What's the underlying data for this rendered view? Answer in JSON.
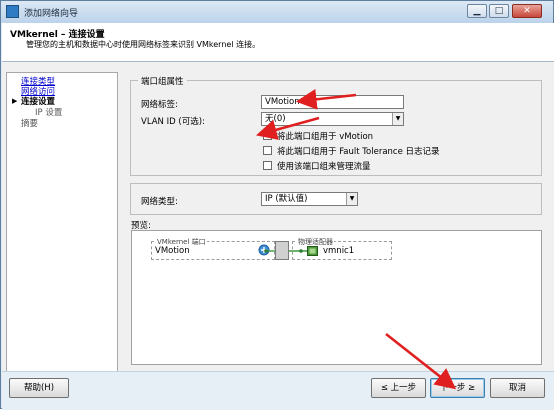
{
  "window": {
    "title": "添加网络向导"
  },
  "header": {
    "title": "VMkernel – 连接设置",
    "subtitle": "管理您的主机和数据中心时使用网络标签来识别 VMkernel 连接。"
  },
  "nav": {
    "items": [
      {
        "label": "连接类型"
      },
      {
        "label": "网络访问"
      },
      {
        "label": "连接设置"
      },
      {
        "label": "IP 设置"
      },
      {
        "label": "摘要"
      }
    ]
  },
  "port_group": {
    "section_title": "端口组属性",
    "network_label_label": "网络标签:",
    "network_label_value": "VMotion",
    "vlan_label": "VLAN ID (可选):",
    "vlan_value": "无(0)",
    "checkbox_vmotion": "将此端口组用于 vMotion",
    "checkbox_fault_tolerance": "将此端口组用于 Fault Tolerance 日志记录",
    "checkbox_management": "使用该端口组来管理流量"
  },
  "network_type": {
    "label": "网络类型:",
    "value": "IP (默认值)"
  },
  "preview": {
    "label": "预览:",
    "vmkernel_port_title": "VMkernel 端口",
    "vmkernel_port_name": "VMotion",
    "adapter_title": "物理适配器",
    "adapter_name": "vmnic1"
  },
  "buttons": {
    "help": "帮助(H)",
    "back": "≤ 上一步",
    "next": "下一步 ≥",
    "cancel": "取消"
  }
}
